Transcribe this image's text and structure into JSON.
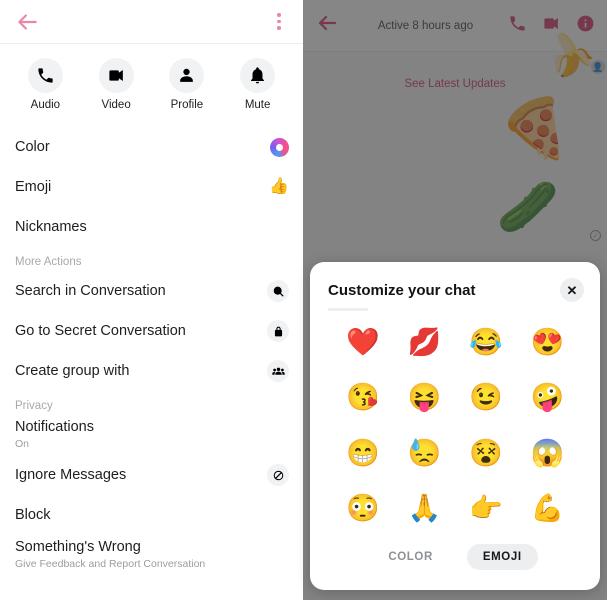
{
  "left_panel": {
    "topbar": {
      "back_icon": "back-arrow-icon",
      "more_icon": "kebab-menu-icon",
      "accent_color": "#e887ab"
    },
    "actions": [
      {
        "label": "Audio",
        "icon": "phone-icon"
      },
      {
        "label": "Video",
        "icon": "video-camera-icon"
      },
      {
        "label": "Profile",
        "icon": "person-icon"
      },
      {
        "label": "Mute",
        "icon": "bell-icon"
      }
    ],
    "menu": [
      {
        "title": "Color",
        "sub": "",
        "icon": "color-ring-icon",
        "type": "ring"
      },
      {
        "title": "Emoji",
        "sub": "",
        "icon": "thumbs-up-icon",
        "type": "emoji",
        "glyph": "👍"
      },
      {
        "title": "Nicknames",
        "sub": "",
        "icon": "",
        "type": "none"
      },
      {
        "title": "More Actions",
        "sub": "",
        "icon": "",
        "type": "section"
      },
      {
        "title": "Search in Conversation",
        "sub": "",
        "icon": "search-icon",
        "type": "circle"
      },
      {
        "title": "Go to Secret Conversation",
        "sub": "",
        "icon": "lock-icon",
        "type": "circle"
      },
      {
        "title": "Create group with",
        "sub": "",
        "icon": "group-people-icon",
        "type": "circle"
      },
      {
        "title": "Privacy",
        "sub": "",
        "icon": "",
        "type": "section"
      },
      {
        "title": "Notifications",
        "sub": "On",
        "icon": "",
        "type": "none"
      },
      {
        "title": "Ignore Messages",
        "sub": "",
        "icon": "ignore-icon",
        "type": "circle"
      },
      {
        "title": "Block",
        "sub": "",
        "icon": "",
        "type": "none"
      },
      {
        "title": "Something's Wrong",
        "sub": "Give Feedback and Report Conversation",
        "icon": "",
        "type": "none"
      }
    ]
  },
  "right_panel": {
    "topbar": {
      "back_icon": "back-arrow-icon",
      "status": "Active 8 hours ago",
      "icons": [
        "phone-icon",
        "video-camera-icon",
        "info-icon"
      ],
      "accent_color": "#d1346b"
    },
    "chat": {
      "see_updates": "See Latest Updates",
      "stickers": [
        {
          "name": "banana-sticker",
          "glyph": "🍌"
        },
        {
          "name": "pizza-sticker",
          "glyph": "🍕"
        },
        {
          "name": "cucumber-sticker",
          "glyph": "🥒"
        }
      ],
      "seen_indicator": "✓",
      "avatar_glyph": "👤"
    }
  },
  "sheet": {
    "title": "Customize your chat",
    "close_label": "✕",
    "emojis": [
      {
        "name": "red-heart",
        "glyph": "❤️"
      },
      {
        "name": "kiss-mark",
        "glyph": "💋"
      },
      {
        "name": "face-with-tears-of-joy",
        "glyph": "😂"
      },
      {
        "name": "smiling-face-heart-eyes",
        "glyph": "😍"
      },
      {
        "name": "face-blowing-a-kiss",
        "glyph": "😘"
      },
      {
        "name": "squinting-tongue-face",
        "glyph": "😝"
      },
      {
        "name": "winking-face",
        "glyph": "😉"
      },
      {
        "name": "zany-face",
        "glyph": "🤪"
      },
      {
        "name": "beaming-face",
        "glyph": "😁"
      },
      {
        "name": "downcast-face-sweat",
        "glyph": "😓"
      },
      {
        "name": "dizzy-face",
        "glyph": "😵"
      },
      {
        "name": "face-screaming-in-fear",
        "glyph": "😱"
      },
      {
        "name": "flushed-face",
        "glyph": "😳"
      },
      {
        "name": "folded-hands",
        "glyph": "🙏"
      },
      {
        "name": "backhand-index-right",
        "glyph": "👉"
      },
      {
        "name": "flexed-biceps",
        "glyph": "💪"
      }
    ],
    "tabs": [
      {
        "label": "COLOR",
        "active": false
      },
      {
        "label": "EMOJI",
        "active": true
      }
    ]
  }
}
